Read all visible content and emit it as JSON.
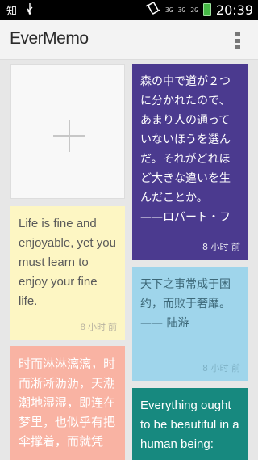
{
  "status_bar": {
    "left_char": "知",
    "usb_icon": "usb-icon",
    "sig1": "3G",
    "sig2": "3G",
    "sig3": "2G",
    "time": "20:39"
  },
  "app": {
    "title": "EverMemo"
  },
  "notes": [
    {
      "text": "Life is fine and enjoyable, yet you must learn to enjoy your fine life.",
      "time": "8 小时 前",
      "bg": "#fdf6c3",
      "fg": "#5a5a5a"
    },
    {
      "text": "时而淋淋漓漓，时而淅淅沥沥，天潮潮地湿湿，即连在梦里，也似乎有把伞撑着，而就凭",
      "time": "",
      "bg": "#f9b3a3",
      "fg": "#ffffff"
    },
    {
      "text": "森の中で道が２つに分かれたので、あまり人の通っていないほうを選んだ。それがどれほど大きな違いを生んだことか。\n——ロバート・フ",
      "time": "8 小时 前",
      "bg": "#4b3a8f",
      "fg": "#ffffff"
    },
    {
      "text": "天下之事常成于困约，而败于奢靡。\n—— 陆游",
      "time": "8 小时 前",
      "bg": "#9fd5eb",
      "fg": "#3d6878"
    },
    {
      "text": "Everything ought to be beautiful in a human being:",
      "time": "",
      "bg": "#17897f",
      "fg": "#ffffff"
    }
  ],
  "colors": {
    "add_plus": "#c7c7c7"
  }
}
